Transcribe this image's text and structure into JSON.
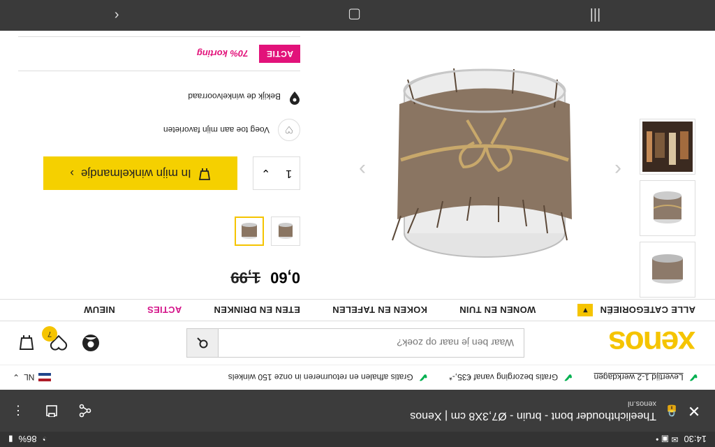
{
  "status": {
    "time": "14:30",
    "battery": "86%"
  },
  "browser": {
    "tab_title": "Theelichthouder bont - bruin - Ø7,3X8 cm | Xenos",
    "domain": "xenos.nl"
  },
  "usps": [
    "Levertijd 1-2 werkdagen",
    "Gratis bezorging vanaf €35,-*",
    "Gratis afhalen en retourneren in onze 150 winkels"
  ],
  "language": "NL",
  "header": {
    "logo": "xenos",
    "search_placeholder": "Waar ben je naar op zoek?",
    "wishlist_count": "7"
  },
  "nav": {
    "categories_label": "ALLE CATEGORIEËN",
    "items": [
      "WONEN EN TUIN",
      "KOKEN EN TAFELEN",
      "ETEN EN DRINKEN",
      "ACTIES",
      "NIEUW"
    ]
  },
  "product": {
    "old_price": "1,99",
    "new_price": "0,60",
    "quantity": "1",
    "cart_label": "In mijn winkelmandje",
    "favorite_label": "Voeg toe aan mijn favorieten",
    "stock_label": "Bekijk de winkelvoorraad",
    "promo_tag": "ACTIE",
    "promo_text": "70% korting"
  },
  "colors": {
    "brand_yellow": "#f5c400",
    "promo_pink": "#e2127a",
    "check_green": "#00b050"
  }
}
